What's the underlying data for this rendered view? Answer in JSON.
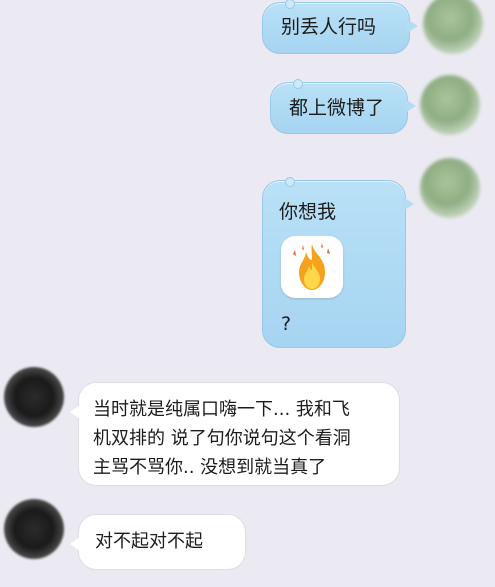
{
  "messages": [
    {
      "sender": "me",
      "text": "别丢人行吗"
    },
    {
      "sender": "me",
      "text": "都上微博了"
    },
    {
      "sender": "me",
      "text": "你想我",
      "emoji": "fire-emoji",
      "trailing": "?"
    },
    {
      "sender": "other",
      "lines": [
        "当时就是纯属口嗨一下... 我和飞",
        "机双排的 说了句你说句这个看洞",
        "主骂不骂你.. 没想到就当真了"
      ]
    },
    {
      "sender": "other",
      "text": "对不起对不起"
    }
  ],
  "colors": {
    "background": "#ebeaf3",
    "my_bubble": "#aed9f4",
    "other_bubble": "#ffffff",
    "fire_orange": "#f6a21c",
    "fire_yellow": "#ffd84a"
  }
}
